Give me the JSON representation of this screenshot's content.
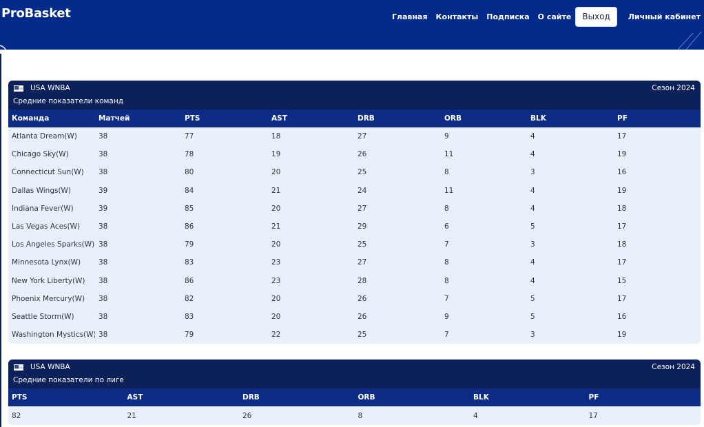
{
  "header": {
    "brand": "ProBasket",
    "nav": [
      {
        "label": "Главная"
      },
      {
        "label": "Контакты"
      },
      {
        "label": "Подписка"
      },
      {
        "label": "О сайте"
      }
    ],
    "logout_label": "Выход",
    "account_label": "Личный кабинет",
    "bg_color": "#022a8a"
  },
  "team_table": {
    "league": "USA WNBA",
    "season": "Сезон 2024",
    "subtitle": "Средние показатели команд",
    "columns": [
      "Команда",
      "Матчей",
      "PTS",
      "AST",
      "DRB",
      "ORB",
      "BLK",
      "PF"
    ],
    "rows": [
      [
        "Atlanta Dream(W)",
        "38",
        "77",
        "18",
        "27",
        "9",
        "4",
        "17"
      ],
      [
        "Chicago Sky(W)",
        "38",
        "78",
        "19",
        "26",
        "11",
        "4",
        "19"
      ],
      [
        "Connecticut Sun(W)",
        "38",
        "80",
        "20",
        "25",
        "8",
        "3",
        "16"
      ],
      [
        "Dallas Wings(W)",
        "39",
        "84",
        "21",
        "24",
        "11",
        "4",
        "19"
      ],
      [
        "Indiana Fever(W)",
        "39",
        "85",
        "20",
        "27",
        "8",
        "4",
        "18"
      ],
      [
        "Las Vegas Aces(W)",
        "38",
        "86",
        "21",
        "29",
        "6",
        "5",
        "17"
      ],
      [
        "Los Angeles Sparks(W)",
        "38",
        "79",
        "20",
        "25",
        "7",
        "3",
        "18"
      ],
      [
        "Minnesota Lynx(W)",
        "38",
        "83",
        "23",
        "27",
        "8",
        "4",
        "17"
      ],
      [
        "New York Liberty(W)",
        "38",
        "86",
        "23",
        "28",
        "8",
        "4",
        "15"
      ],
      [
        "Phoenix Mercury(W)",
        "38",
        "82",
        "20",
        "26",
        "7",
        "5",
        "17"
      ],
      [
        "Seattle Storm(W)",
        "38",
        "83",
        "20",
        "26",
        "9",
        "5",
        "16"
      ],
      [
        "Washington Mystics(W)",
        "38",
        "79",
        "22",
        "25",
        "7",
        "3",
        "19"
      ]
    ]
  },
  "league_table": {
    "league": "USA WNBA",
    "season": "Сезон 2024",
    "subtitle": "Средние показатели по лиге",
    "columns": [
      "PTS",
      "AST",
      "DRB",
      "ORB",
      "BLK",
      "PF"
    ],
    "rows": [
      [
        "82",
        "21",
        "26",
        "8",
        "4",
        "17"
      ]
    ]
  }
}
